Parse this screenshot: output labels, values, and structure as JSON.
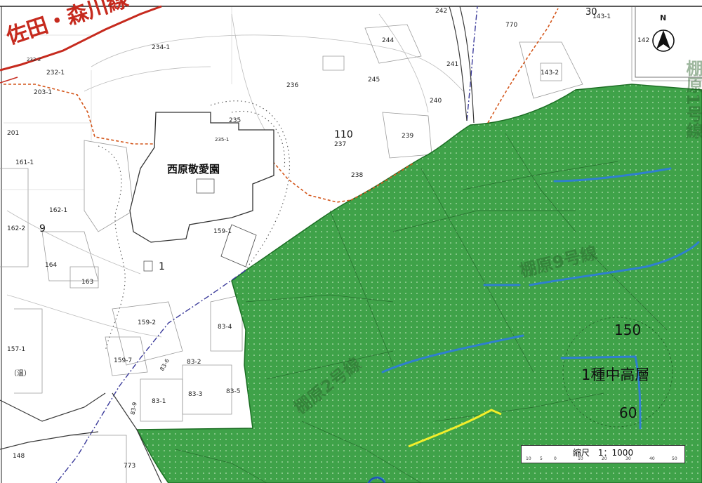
{
  "map": {
    "roads": {
      "sada_morikawa": "佐田・森川線",
      "tanahara_1": "棚原1号線",
      "tanahara_2": "棚原2号線",
      "tanahara_9": "棚原9号線"
    },
    "facility": "西原敬愛園",
    "zone": {
      "floor_area_ratio": "150",
      "category": "1種中高層",
      "building_coverage": "60"
    },
    "lot_numbers": [
      "232-2",
      "232-1",
      "203-1",
      "201",
      "161-1",
      "162-1",
      "162-2",
      "164",
      "163",
      "157-1",
      "（温）",
      "159-2",
      "159-7",
      "83-6",
      "83-2",
      "83-1",
      "83-3",
      "83-5",
      "83-4",
      "159-1",
      "234-1",
      "236",
      "235",
      "235-1",
      "244",
      "245",
      "241",
      "240",
      "239",
      "237",
      "238",
      "110",
      "770",
      "142",
      "143-2",
      "143-1",
      "30",
      "242",
      "1",
      "9",
      "148",
      "773",
      "83-9"
    ],
    "north_label": "N",
    "scale": {
      "title": "縮尺　1：1000",
      "ticks": [
        "10",
        "5",
        "0",
        "10",
        "20",
        "30",
        "40",
        "50"
      ]
    },
    "colors": {
      "zone_fill": "#2f9a3a",
      "city_road": "#c62a1e",
      "boundary": "#d4571c",
      "stream": "#2f7fd0",
      "district_line": "#3a3a9a",
      "yellow_line": "#f2ee2a"
    }
  }
}
